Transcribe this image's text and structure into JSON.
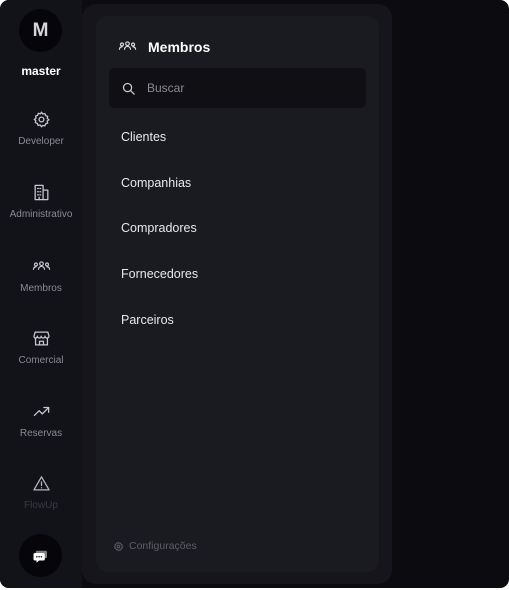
{
  "rail": {
    "avatar_letter": "M",
    "workspace": "master",
    "items": [
      {
        "label": "Developer",
        "icon": "gear-icon"
      },
      {
        "label": "Administrativo",
        "icon": "building-icon"
      },
      {
        "label": "Membros",
        "icon": "users-icon"
      },
      {
        "label": "Comercial",
        "icon": "store-icon"
      },
      {
        "label": "Reservas",
        "icon": "trending-up-icon"
      },
      {
        "label": "FlowUp",
        "icon": "warning-icon"
      }
    ],
    "chat_icon": "chat-icon"
  },
  "panel": {
    "title": "Membros",
    "search": {
      "placeholder": "Buscar",
      "value": ""
    },
    "items": [
      "Clientes",
      "Companhias",
      "Compradores",
      "Fornecedores",
      "Parceiros"
    ],
    "settings_label": "Configurações"
  }
}
